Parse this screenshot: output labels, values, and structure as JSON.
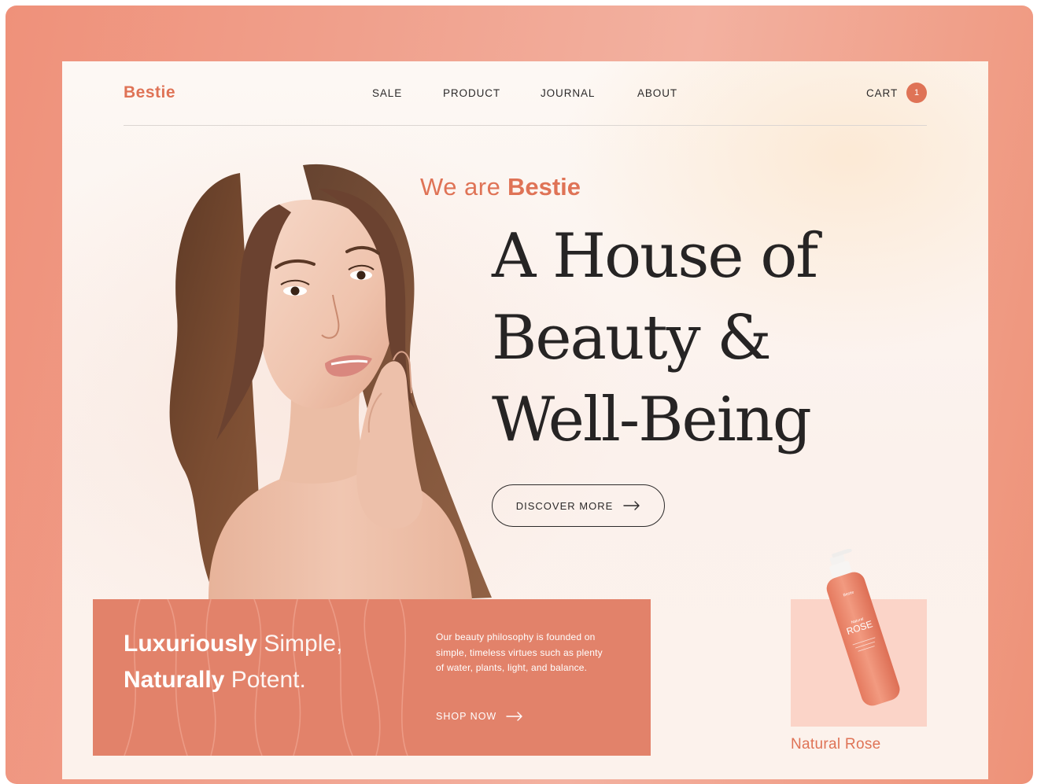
{
  "brand": {
    "name": "Bestie",
    "accent_color": "#df7356"
  },
  "nav": {
    "items": [
      "SALE",
      "PRODUCT",
      "JOURNAL",
      "ABOUT"
    ],
    "cart_label": "CART",
    "cart_count": "1"
  },
  "hero": {
    "eyebrow_light": "We are",
    "eyebrow_bold": "Bestie",
    "headline_lines": [
      "A House of",
      "Beauty &",
      "Well-Being"
    ],
    "cta_label": "DISCOVER MORE",
    "cta_icon": "arrow-right-icon"
  },
  "promo": {
    "line1_bold": "Luxuriously",
    "line1_light": "Simple,",
    "line2_bold": "Naturally",
    "line2_light": "Potent.",
    "copy": "Our beauty philosophy is founded on simple, timeless virtues such as plenty of water, plants, light, and balance.",
    "shop_label": "SHOP NOW",
    "shop_icon": "arrow-right-icon",
    "background_color": "#e2826a"
  },
  "product": {
    "name": "Natural Rose",
    "bottle_brand": "Bestie",
    "bottle_small_label": "Natural",
    "bottle_label": "ROSE",
    "card_color": "#fbd4c8"
  }
}
